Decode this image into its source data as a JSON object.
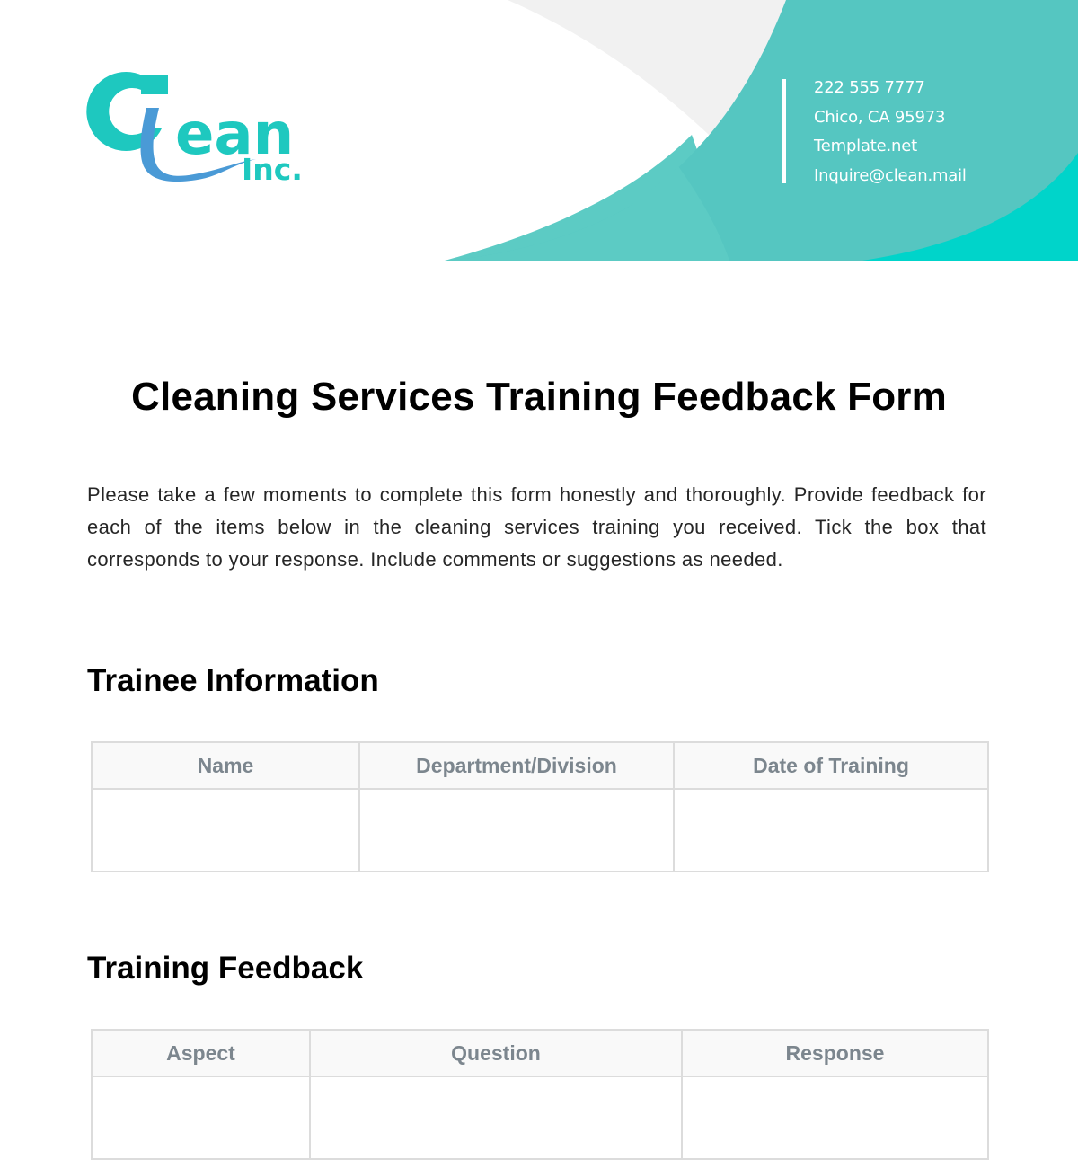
{
  "header": {
    "logo": {
      "main_text": "ean",
      "initial": "C",
      "sub_text": "Inc.",
      "colors": {
        "teal": "#1ec8bf",
        "blue": "#4a9ad6"
      }
    },
    "contact": {
      "phone": "222 555 7777",
      "address": "Chico, CA 95973",
      "website": "Template.net",
      "email": "Inquire@clean.mail"
    },
    "colors": {
      "teal": "#55c6c1",
      "teal_light": "#5ccbc4",
      "cyan": "#00d4ca",
      "gray": "#f1f1f1"
    }
  },
  "document": {
    "title": "Cleaning Services Training Feedback Form",
    "intro": "Please take a few moments to complete this form honestly and thoroughly. Provide feedback for each of the items below in the cleaning services training you received. Tick the box that corresponds to your response. Include comments or suggestions as needed."
  },
  "trainee_information": {
    "heading": "Trainee Information",
    "columns": [
      "Name",
      "Department/Division",
      "Date of Training"
    ],
    "rows": [
      [
        "",
        "",
        ""
      ]
    ]
  },
  "training_feedback": {
    "heading": "Training Feedback",
    "columns": [
      "Aspect",
      "Question",
      "Response"
    ]
  }
}
